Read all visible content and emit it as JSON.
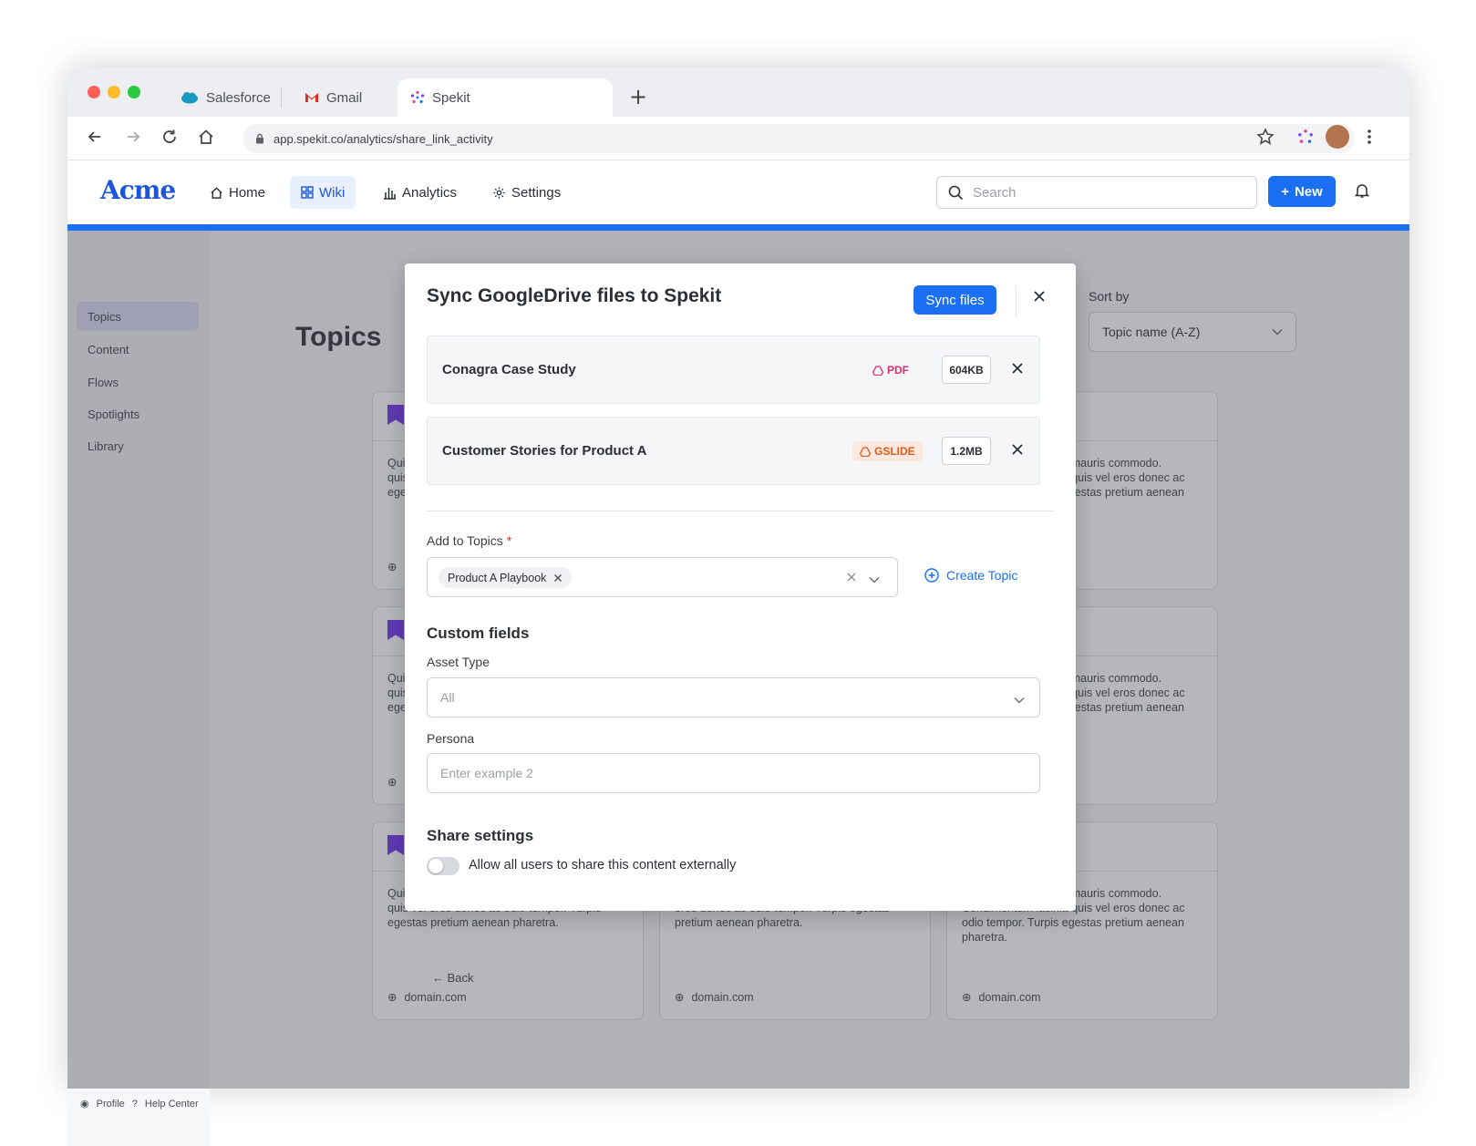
{
  "browser": {
    "tabs": [
      {
        "label": "Salesforce",
        "icon": "salesforce-cloud-icon"
      },
      {
        "label": "Gmail",
        "icon": "gmail-icon"
      },
      {
        "label": "Spekit",
        "icon": "spekit-icon"
      }
    ],
    "url": "app.spekit.co/analytics/share_link_activity"
  },
  "app": {
    "logo": "Acme",
    "nav": [
      {
        "label": "Home",
        "icon": "home-icon"
      },
      {
        "label": "Wiki",
        "icon": "grid-icon"
      },
      {
        "label": "Analytics",
        "icon": "bar-chart-icon"
      },
      {
        "label": "Settings",
        "icon": "gear-icon"
      }
    ],
    "search_placeholder": "Search",
    "new_button": "New"
  },
  "sidebar": {
    "items": [
      "Topics",
      "Content",
      "Flows",
      "Spotlights",
      "Library"
    ],
    "footer_profile": "Profile",
    "footer_help": "Help Center"
  },
  "page": {
    "title": "Topics",
    "sort_label": "Sort by",
    "sort_value": "Topic name (A-Z)",
    "back_label": "Back",
    "card_text_left": "Quis mauris commodo. Condimentum lacinia quis vel eros donec ac odio tempor. Turpis egestas pretium aenean pharetra.",
    "card_text_right": "Vulputate mi sit amet mauris commodo. Condimentum lacinia quis vel eros donec ac odio tempor. Turpis egestas pretium aenean pharetra.",
    "card_text_middle": "mauris commodo. Condimentum lacinia quis vel eros donec ac odio tempor. Turpis egestas pretium aenean pharetra.",
    "card_domain": "domain.com"
  },
  "modal": {
    "title": "Sync GoogleDrive files to Spekit",
    "sync_button": "Sync files",
    "files": [
      {
        "name": "Conagra Case Study",
        "type": "PDF",
        "size": "604KB"
      },
      {
        "name": "Customer Stories for Product A",
        "type": "GSLIDE",
        "size": "1.2MB"
      }
    ],
    "add_to_topics_label": "Add to Topics",
    "required_mark": "*",
    "selected_topic": "Product A Playbook",
    "create_topic": "Create Topic",
    "custom_fields_title": "Custom fields",
    "asset_type_label": "Asset Type",
    "asset_type_value": "All",
    "persona_label": "Persona",
    "persona_placeholder": "Enter example 2",
    "share_settings_title": "Share settings",
    "share_toggle_label": "Allow all users to share this content externally",
    "share_toggle_on": false
  },
  "colors": {
    "accent": "#1a6ff5",
    "brand": "#1a56db",
    "pdf": "#d8336a",
    "gslide": "#e05a1b"
  }
}
